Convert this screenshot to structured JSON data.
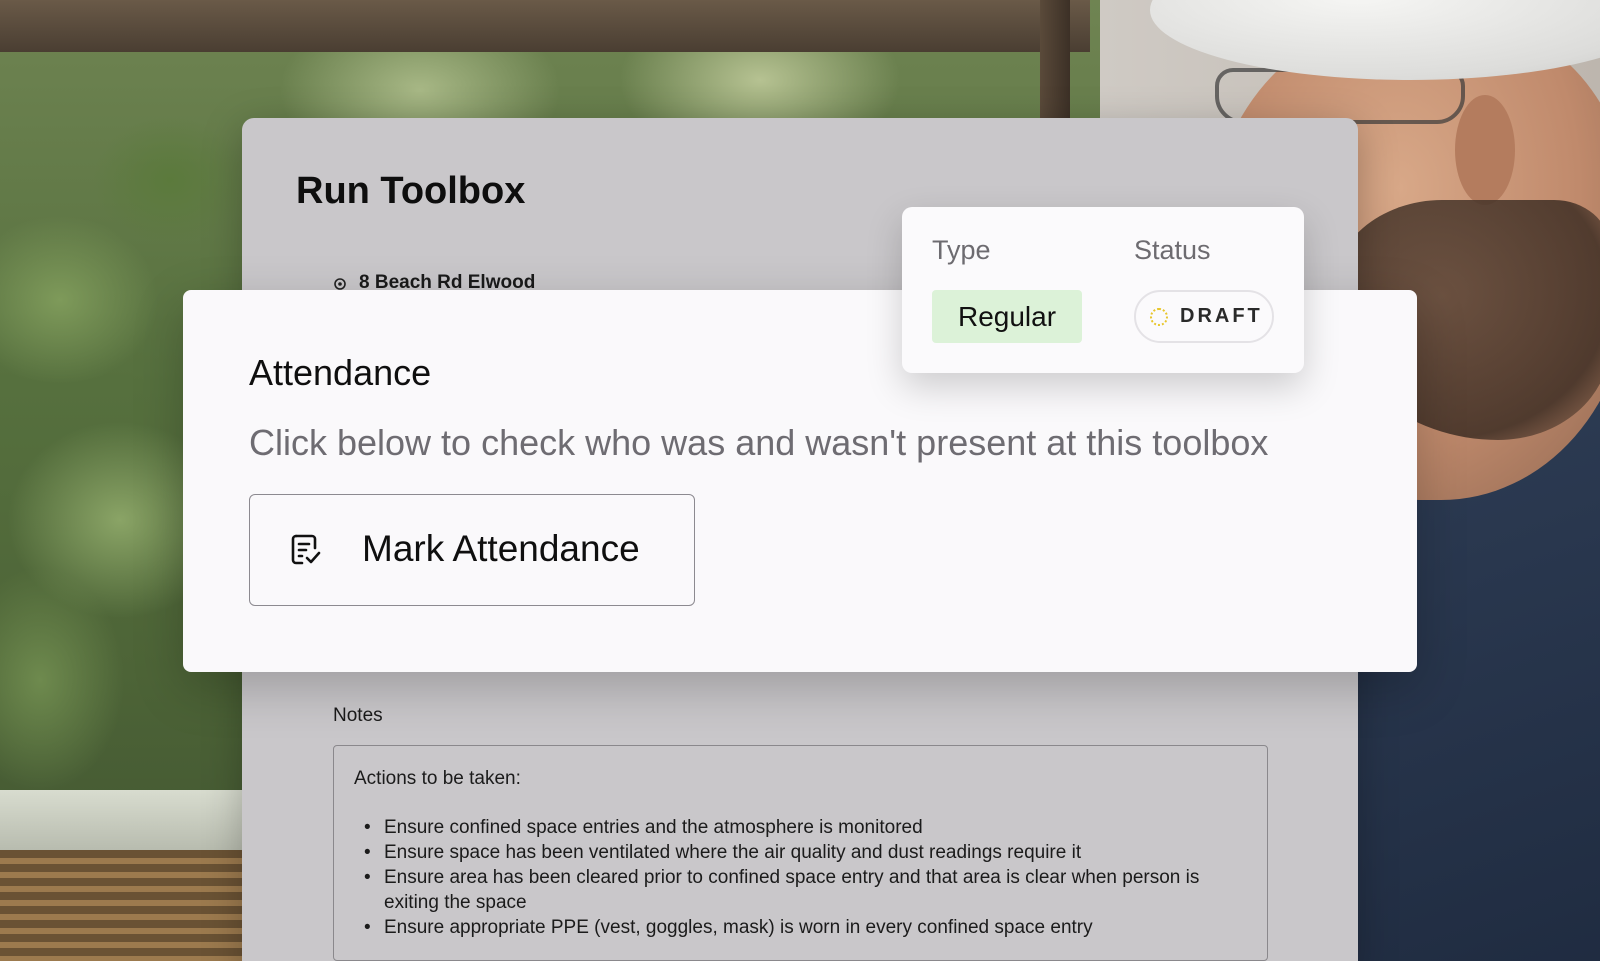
{
  "page": {
    "title": "Run Toolbox",
    "location": "8 Beach Rd Elwood"
  },
  "info": {
    "type_label": "Type",
    "type_value": "Regular",
    "status_label": "Status",
    "status_value": "DRAFT",
    "colors": {
      "type_badge_bg": "#dcf2d8",
      "status_dot": "#e8c62c"
    }
  },
  "attendance": {
    "title": "Attendance",
    "description": "Click below to check who was and wasn't present at this toolbox",
    "button_label": "Mark Attendance",
    "button_icon": "checklist-icon"
  },
  "notes": {
    "label": "Notes",
    "heading": "Actions to be taken:",
    "items": [
      "Ensure confined space entries and the atmosphere is monitored",
      "Ensure space has been ventilated where the air quality and dust readings require it",
      "Ensure area has been cleared prior to confined space entry and that area is clear when person is exiting the space",
      "Ensure appropriate PPE (vest, goggles, mask) is worn in every confined space entry"
    ]
  }
}
